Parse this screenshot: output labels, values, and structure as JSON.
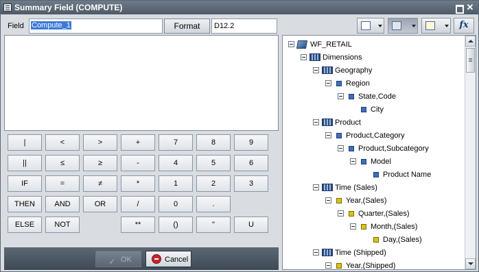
{
  "window": {
    "title": "Summary Field (COMPUTE)"
  },
  "field": {
    "label": "Field",
    "value": "Compute_1"
  },
  "format": {
    "button_label": "Format",
    "value": "D12.2"
  },
  "toolbar": {
    "fx_label": "fx"
  },
  "keypad": {
    "rows": [
      [
        "|",
        "<",
        ">",
        "+",
        "7",
        "8",
        "9"
      ],
      [
        "||",
        "≤",
        "≥",
        "-",
        "4",
        "5",
        "6"
      ],
      [
        "IF",
        "=",
        "≠",
        "*",
        "1",
        "2",
        "3"
      ],
      [
        "THEN",
        "AND",
        "OR",
        "/",
        "0",
        "."
      ],
      [
        "ELSE",
        "NOT",
        "",
        "**",
        "()",
        "\"",
        "U"
      ]
    ]
  },
  "footer": {
    "ok_label": "OK",
    "cancel_label": "Cancel"
  },
  "tree": {
    "items": [
      {
        "label": "WF_RETAIL",
        "depth": 0,
        "icon": "cube",
        "expanded": true
      },
      {
        "label": "Dimensions",
        "depth": 1,
        "icon": "dimensions",
        "expanded": true
      },
      {
        "label": "Geography",
        "depth": 2,
        "icon": "dimensions",
        "expanded": true
      },
      {
        "label": "Region",
        "depth": 3,
        "icon": "level-blue",
        "expanded": true
      },
      {
        "label": "State,Code",
        "depth": 4,
        "icon": "level-blue",
        "expanded": true
      },
      {
        "label": "City",
        "depth": 5,
        "icon": "level-blue",
        "expanded": null
      },
      {
        "label": "Product",
        "depth": 2,
        "icon": "dimensions",
        "expanded": true
      },
      {
        "label": "Product,Category",
        "depth": 3,
        "icon": "level-blue",
        "expanded": true
      },
      {
        "label": "Product,Subcategory",
        "depth": 4,
        "icon": "level-blue",
        "expanded": true
      },
      {
        "label": "Model",
        "depth": 5,
        "icon": "level-blue",
        "expanded": true
      },
      {
        "label": "Product Name",
        "depth": 6,
        "icon": "level-blue",
        "expanded": null
      },
      {
        "label": "Time (Sales)",
        "depth": 2,
        "icon": "dimensions",
        "expanded": true
      },
      {
        "label": "Year,(Sales)",
        "depth": 3,
        "icon": "level-yellow",
        "expanded": true
      },
      {
        "label": "Quarter,(Sales)",
        "depth": 4,
        "icon": "level-yellow",
        "expanded": true
      },
      {
        "label": "Month,(Sales)",
        "depth": 5,
        "icon": "level-yellow",
        "expanded": true
      },
      {
        "label": "Day,(Sales)",
        "depth": 6,
        "icon": "level-yellow",
        "expanded": null
      },
      {
        "label": "Time (Shipped)",
        "depth": 2,
        "icon": "dimensions",
        "expanded": true
      },
      {
        "label": "Year,(Shipped)",
        "depth": 3,
        "icon": "level-yellow",
        "expanded": true
      }
    ]
  }
}
